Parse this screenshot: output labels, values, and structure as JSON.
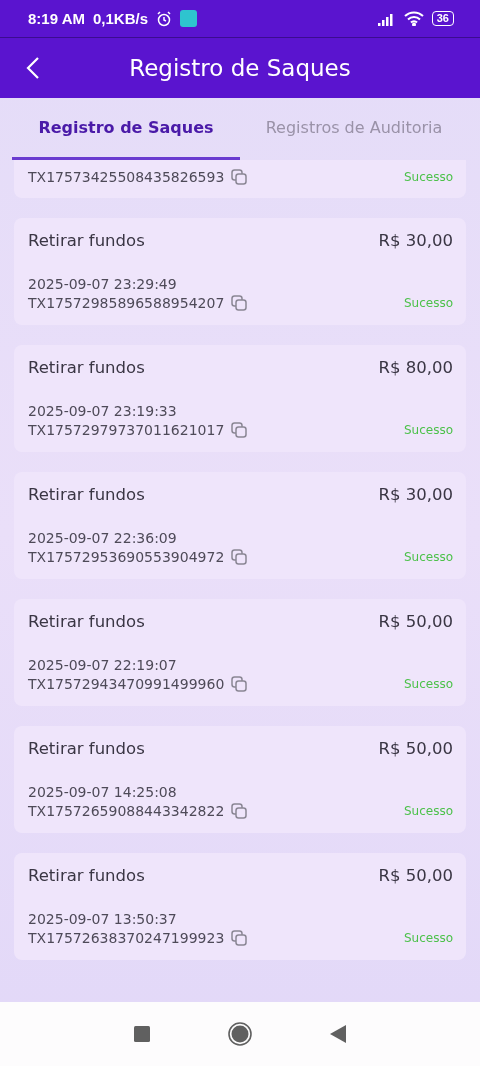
{
  "status_bar": {
    "time": "8:19 AM",
    "speed": "0,1KB/s",
    "battery": "36"
  },
  "header": {
    "title": "Registro de Saques"
  },
  "tabs": [
    {
      "label": "Registro de Saques",
      "selected": true
    },
    {
      "label": "Registros de Auditoria",
      "selected": false
    }
  ],
  "records": [
    {
      "kind": "partial",
      "tx": "TX17573425508435826593",
      "status": "Sucesso"
    },
    {
      "kind": "full",
      "title": "Retirar fundos",
      "amount": "R$ 30,00",
      "datetime": "2025-09-07 23:29:49",
      "tx": "TX17572985896588954207",
      "status": "Sucesso"
    },
    {
      "kind": "full",
      "title": "Retirar fundos",
      "amount": "R$ 80,00",
      "datetime": "2025-09-07 23:19:33",
      "tx": "TX17572979737011621017",
      "status": "Sucesso"
    },
    {
      "kind": "full",
      "title": "Retirar fundos",
      "amount": "R$ 30,00",
      "datetime": "2025-09-07 22:36:09",
      "tx": "TX17572953690553904972",
      "status": "Sucesso"
    },
    {
      "kind": "full",
      "title": "Retirar fundos",
      "amount": "R$ 50,00",
      "datetime": "2025-09-07 22:19:07",
      "tx": "TX17572943470991499960",
      "status": "Sucesso"
    },
    {
      "kind": "full",
      "title": "Retirar fundos",
      "amount": "R$ 50,00",
      "datetime": "2025-09-07 14:25:08",
      "tx": "TX17572659088443342822",
      "status": "Sucesso"
    },
    {
      "kind": "full",
      "title": "Retirar fundos",
      "amount": "R$ 50,00",
      "datetime": "2025-09-07 13:50:37",
      "tx": "TX17572638370247199923",
      "status": "Sucesso"
    }
  ]
}
